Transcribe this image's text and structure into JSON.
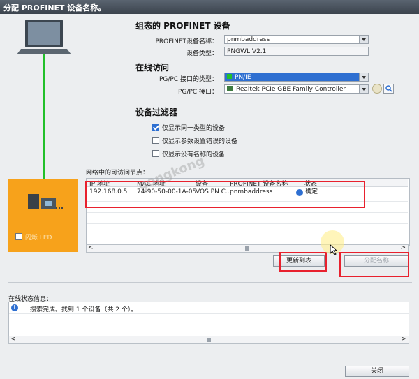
{
  "title": "分配 PROFINET 设备名称。",
  "configured": {
    "heading": "组态的 PROFINET 设备",
    "name_label": "PROFINET设备名称：",
    "name_value": "pnmbaddress",
    "type_label": "设备类型：",
    "type_value": "PNGWL V2.1"
  },
  "online": {
    "heading": "在线访问",
    "iface_type_label": "PG/PC 接口的类型：",
    "iface_type_value": "PN/IE",
    "iface_label": "PG/PC 接口：",
    "iface_value": "Realtek PCIe GBE Family Controller"
  },
  "filter": {
    "heading": "设备过滤器",
    "options": [
      {
        "label": "仅显示同一类型的设备",
        "checked": true
      },
      {
        "label": "仅显示参数设置错误的设备",
        "checked": false
      },
      {
        "label": "仅显示没有名称的设备",
        "checked": false
      }
    ]
  },
  "nodes": {
    "caption": "网络中的可访问节点：",
    "columns": [
      "IP 地址",
      "MAC 地址",
      "设备",
      "PROFINET 设备名称",
      "状态"
    ],
    "rows": [
      {
        "ip": "192.168.0.5",
        "mac": "74-90-50-00-1A-05",
        "device": "VOS PN C...",
        "name": "pnmbaddress",
        "status": "确定"
      }
    ]
  },
  "device_panel": {
    "flash_label": "闪烁 LED"
  },
  "buttons": {
    "refresh": "更新列表",
    "assign": "分配名称",
    "close": "关闭"
  },
  "status": {
    "caption": "在线状态信息：",
    "message": "搜索完成。找到 1 个设备（共 2 个）。"
  },
  "watermark": "gongkong",
  "colors": {
    "accent_orange": "#f7a21b",
    "link_green": "#22c02a",
    "highlight_red": "#e8212e",
    "selection_blue": "#2e6fd1"
  }
}
